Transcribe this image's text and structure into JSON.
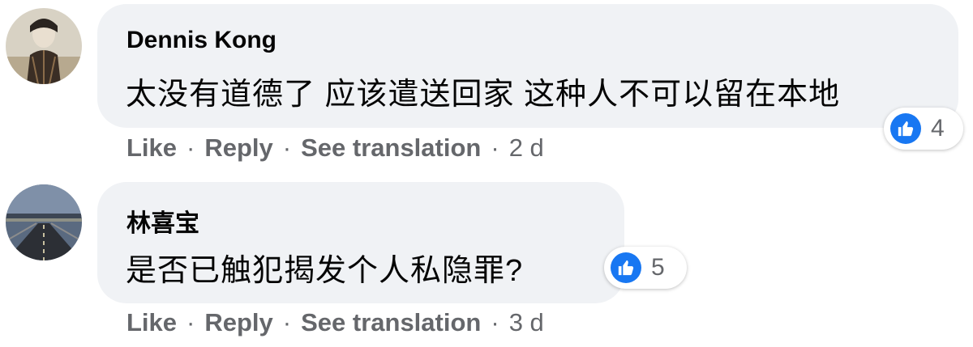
{
  "comments": [
    {
      "author": "Dennis Kong",
      "text": "太没有道德了 应该遣送回家 这种人不可以留在本地",
      "reaction_count": "4",
      "actions": {
        "like": "Like",
        "reply": "Reply",
        "translate": "See translation",
        "separator": "·",
        "time": "2 d"
      }
    },
    {
      "author": "林喜宝",
      "text": "是否已触犯揭发个人私隐罪?",
      "reaction_count": "5",
      "actions": {
        "like": "Like",
        "reply": "Reply",
        "translate": "See translation",
        "separator": "·",
        "time": "3 d"
      }
    }
  ],
  "colors": {
    "bubble_bg": "#f0f2f5",
    "text_primary": "#050505",
    "text_secondary": "#65676b",
    "like_blue": "#1877f2"
  },
  "icons": {
    "reaction": "thumbs-up-icon"
  }
}
